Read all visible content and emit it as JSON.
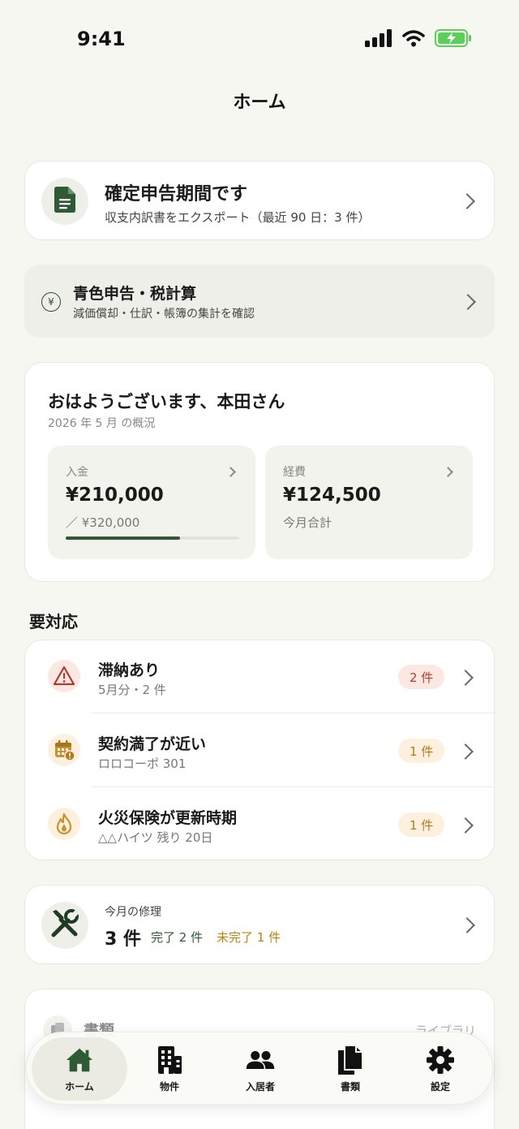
{
  "status": {
    "time": "9:41"
  },
  "nav": {
    "title": "ホーム"
  },
  "tax_card": {
    "title": "確定申告期間です",
    "subtitle": "収支内訳書をエクスポート（最近 90 日：3 件）"
  },
  "blue_card": {
    "icon_text": "¥",
    "title": "青色申告・税計算",
    "subtitle": "減価償却・仕訳・帳簿の集計を確認"
  },
  "summary": {
    "greeting": "おはようございます、本田さん",
    "period": "2026 年 5 月 の概況",
    "income": {
      "label": "入金",
      "value": "¥210,000",
      "note": "／ ¥320,000",
      "progress_percent": 66
    },
    "expense": {
      "label": "経費",
      "value": "¥124,500",
      "note": "今月合計"
    }
  },
  "action_section": {
    "title": "要対応",
    "items": [
      {
        "icon": "warning-icon",
        "title": "滞納あり",
        "subtitle": "5月分・2 件",
        "badge": "2 件",
        "badge_color": "#b03a2e"
      },
      {
        "icon": "calendar-alert-icon",
        "title": "契約満了が近い",
        "subtitle": "ロロコーポ 301",
        "badge": "1 件",
        "badge_color": "#b5791e"
      },
      {
        "icon": "fire-icon",
        "title": "火災保険が更新時期",
        "subtitle": "△△ハイツ 残り 20日",
        "badge": "1 件",
        "badge_color": "#b5791e"
      }
    ]
  },
  "repairs": {
    "label": "今月の修理",
    "count": "3 件",
    "done": "完了 2 件",
    "pending": "未完了 1 件"
  },
  "documents": {
    "title": "書類",
    "link": "ライブラリ"
  },
  "tab_bar": {
    "tabs": [
      {
        "label": "ホーム",
        "icon": "home-icon"
      },
      {
        "label": "物件",
        "icon": "building-icon"
      },
      {
        "label": "入居者",
        "icon": "people-icon"
      },
      {
        "label": "書類",
        "icon": "documents-icon"
      },
      {
        "label": "設定",
        "icon": "gear-icon"
      }
    ]
  },
  "colors": {
    "accent": "#2f5a36",
    "background": "#f7f7f2",
    "danger": "#b03a2e",
    "warning": "#b5791e",
    "battery": "#5ccf5a"
  }
}
